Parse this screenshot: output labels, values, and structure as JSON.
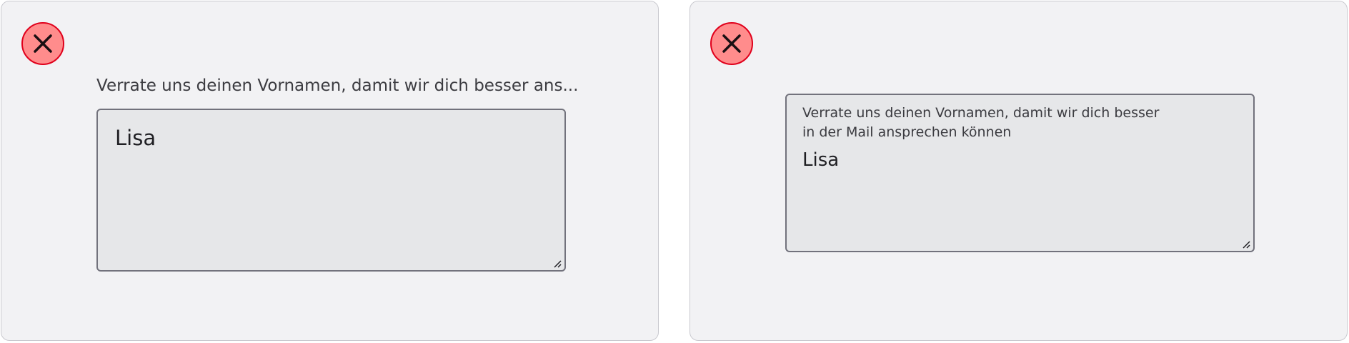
{
  "variants": [
    {
      "label": "Verrate uns deinen Vornamen, damit wir dich besser ans...",
      "value": "Lisa",
      "status_icon": "error-close-icon"
    },
    {
      "label_line1": "Verrate uns deinen Vornamen, damit wir dich besser",
      "label_line2": "in der Mail ansprechen können",
      "value": "Lisa",
      "status_icon": "error-close-icon"
    }
  ],
  "colors": {
    "panel_bg": "#f2f2f4",
    "panel_border": "#c9c9cf",
    "textarea_bg": "#e6e7e9",
    "textarea_border": "#72727c",
    "error_fill": "#ff8c8c",
    "error_border": "#e0001b"
  }
}
